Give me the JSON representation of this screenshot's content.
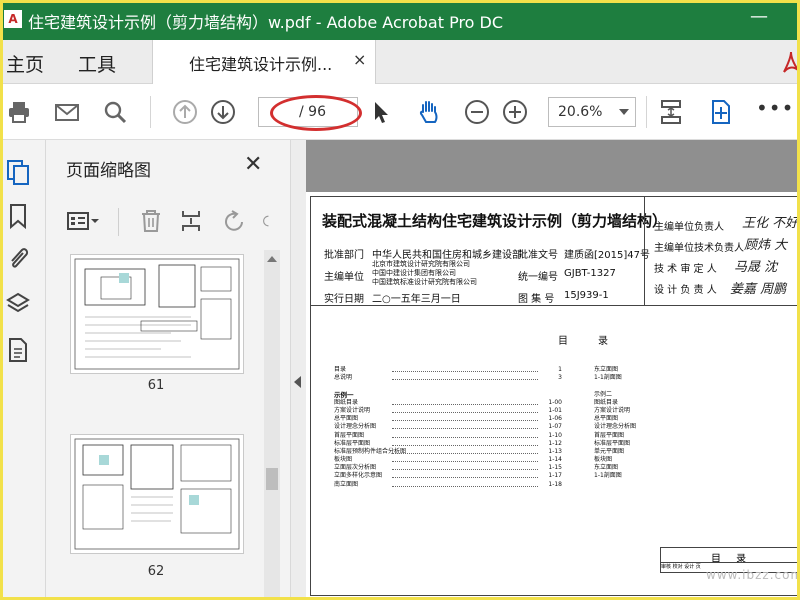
{
  "window": {
    "title": "住宅建筑设计示例（剪力墙结构）w.pdf - Adobe Acrobat Pro DC",
    "app_icon": "acrobat-icon",
    "minimize_glyph": "—"
  },
  "tabs": {
    "home": "主页",
    "tools": "工具",
    "document": "住宅建筑设计示例...",
    "close_glyph": "×"
  },
  "toolbar": {
    "current_page": "",
    "page_total": "/ 96",
    "zoom": "20.6%",
    "more": "•••",
    "icons": [
      "print-icon",
      "mail-icon",
      "search-icon",
      "prev-page-icon",
      "next-page-icon",
      "select-arrow-icon",
      "hand-icon",
      "zoom-out-icon",
      "zoom-in-icon",
      "fit-page-icon",
      "full-screen-icon"
    ]
  },
  "rail": {
    "icons": [
      "page-thumbnails-icon",
      "bookmark-icon",
      "attachment-icon",
      "layers-icon",
      "document-properties-icon"
    ]
  },
  "panel": {
    "title": "页面缩略图",
    "close_glyph": "✕",
    "thumbnails": [
      {
        "label": "61"
      },
      {
        "label": "62"
      }
    ]
  },
  "document": {
    "title": "装配式混凝土结构住宅建筑设计示例（剪力墙结构）",
    "meta": {
      "approver_label": "批准部门",
      "approver": "中华人民共和国住房和城乡建设部",
      "doc_no_label": "批准文号",
      "doc_no": "建质函[2015]47号",
      "editor_label": "主编单位",
      "editor_lines": [
        "北京市建筑设计研究院有限公司",
        "中国中建设计集团有限公司",
        "中国建筑标准设计研究院有限公司"
      ],
      "unified_label": "统一编号",
      "unified": "GJBT-1327",
      "date_label": "实行日期",
      "date": "二○一五年三月一日",
      "atlas_label": "图 集 号",
      "atlas": "15J939-1"
    },
    "roles": [
      "主编单位负责人",
      "主编单位技术负责人",
      "技 术 审 定 人",
      "设 计 负 责 人"
    ],
    "signatures": [
      "王化 不好",
      "顾炜 大",
      "马晟 沈",
      "姜嘉 周鹏"
    ],
    "toc_heading_1": "目",
    "toc_heading_2": "录",
    "toc_left": [
      {
        "label": "目录",
        "page": "1",
        "sec": false
      },
      {
        "label": "总说明",
        "page": "3",
        "sec": false
      },
      {
        "label": "",
        "page": "",
        "sec": false
      },
      {
        "label": "示例一",
        "page": "",
        "sec": true
      },
      {
        "label": "图纸目录",
        "page": "1-00",
        "sec": false
      },
      {
        "label": "方案设计说明",
        "page": "1-01",
        "sec": false
      },
      {
        "label": "总平面图",
        "page": "1-06",
        "sec": false
      },
      {
        "label": "设计理念分析图",
        "page": "1-07",
        "sec": false
      },
      {
        "label": "首层平面图",
        "page": "1-10",
        "sec": false
      },
      {
        "label": "标准层平面图",
        "page": "1-12",
        "sec": false
      },
      {
        "label": "标准层预制构件组合分析图",
        "page": "1-13",
        "sec": false
      },
      {
        "label": "板块图",
        "page": "1-14",
        "sec": false
      },
      {
        "label": "立面层次分析图",
        "page": "1-15",
        "sec": false
      },
      {
        "label": "立面多样化示意图",
        "page": "1-17",
        "sec": false
      },
      {
        "label": "南立面图",
        "page": "1-18",
        "sec": false
      }
    ],
    "toc_right": [
      "东立面图",
      "1-1剖面图",
      "",
      "示例二",
      "图纸目录",
      "方案设计说明",
      "总平面图",
      "设计理念分析图",
      "首层平面图",
      "标准层平面图",
      "单元平面图",
      "板块图",
      "东立面图",
      "1-1剖面图"
    ],
    "mini_title": "目 录",
    "mini_row": "审核 校对 设计 页",
    "watermark": "www.ibzz.com"
  }
}
